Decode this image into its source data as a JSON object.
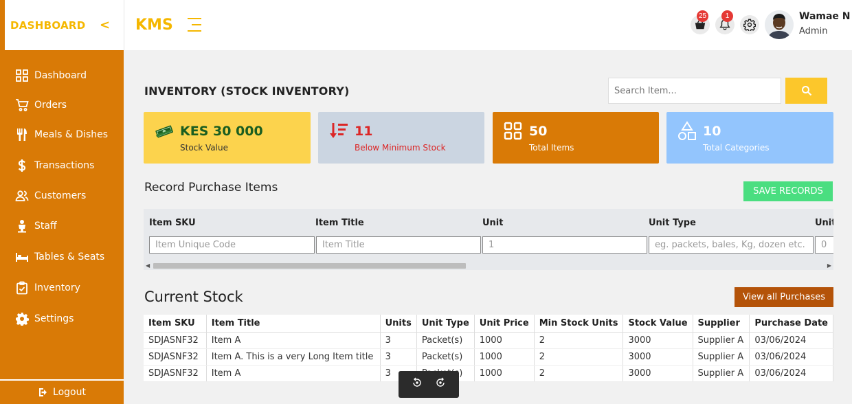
{
  "sidebar": {
    "brand": "DASHBOARD",
    "items": [
      {
        "label": "Dashboard",
        "icon": "grid-icon"
      },
      {
        "label": "Orders",
        "icon": "cart-icon"
      },
      {
        "label": "Meals & Dishes",
        "icon": "utensils-icon"
      },
      {
        "label": "Transactions",
        "icon": "dollar-icon"
      },
      {
        "label": "Customers",
        "icon": "users-icon"
      },
      {
        "label": "Staff",
        "icon": "person-icon"
      },
      {
        "label": "Tables & Seats",
        "icon": "bed-icon"
      },
      {
        "label": "Inventory",
        "icon": "clipboard-check-icon"
      },
      {
        "label": "Settings",
        "icon": "gear-icon"
      }
    ],
    "logout": "Logout"
  },
  "topbar": {
    "logo": "KMS",
    "cart_badge": "25",
    "notif_badge": "1",
    "user_name": "Wamae N",
    "user_role": "Admin"
  },
  "page": {
    "title": "INVENTORY (STOCK INVENTORY)",
    "search_placeholder": "Search Item..."
  },
  "cards": [
    {
      "value": "KES 30 000",
      "label": "Stock Value"
    },
    {
      "value": "11",
      "label": "Below Minimum Stock"
    },
    {
      "value": "50",
      "label": "Total Items"
    },
    {
      "value": "10",
      "label": "Total Categories"
    }
  ],
  "record": {
    "title": "Record Purchase Items",
    "save_label": "SAVE RECORDS",
    "fields": [
      {
        "header": "Item SKU",
        "placeholder": "Item Unique Code"
      },
      {
        "header": "Item Title",
        "placeholder": "Item Title"
      },
      {
        "header": "Unit",
        "placeholder": "1"
      },
      {
        "header": "Unit Type",
        "placeholder": "eg. packets, bales, Kg, dozen etc."
      },
      {
        "header": "Unit",
        "placeholder": "0"
      }
    ]
  },
  "stock": {
    "title": "Current Stock",
    "view_label": "View all Purchases",
    "columns": [
      "Item SKU",
      "Item Title",
      "Units",
      "Unit Type",
      "Unit Price",
      "Min Stock Units",
      "Stock Value",
      "Supplier",
      "Purchase Date"
    ],
    "rows": [
      [
        "SDJASNF32",
        "Item A",
        "3",
        "Packet(s)",
        "1000",
        "2",
        "3000",
        "Supplier A",
        "03/06/2024"
      ],
      [
        "SDJASNF32",
        "Item A. This is a very Long Item title",
        "3",
        "Packet(s)",
        "1000",
        "2",
        "3000",
        "Supplier A",
        "03/06/2024"
      ],
      [
        "SDJASNF32",
        "Item A",
        "3",
        "Packet(s)",
        "1000",
        "2",
        "3000",
        "Supplier A",
        "03/06/2024"
      ]
    ]
  },
  "colors": {
    "sidebar": "#d97a06",
    "accent": "#f5b700",
    "save": "#4ade80",
    "view": "#b45309"
  }
}
